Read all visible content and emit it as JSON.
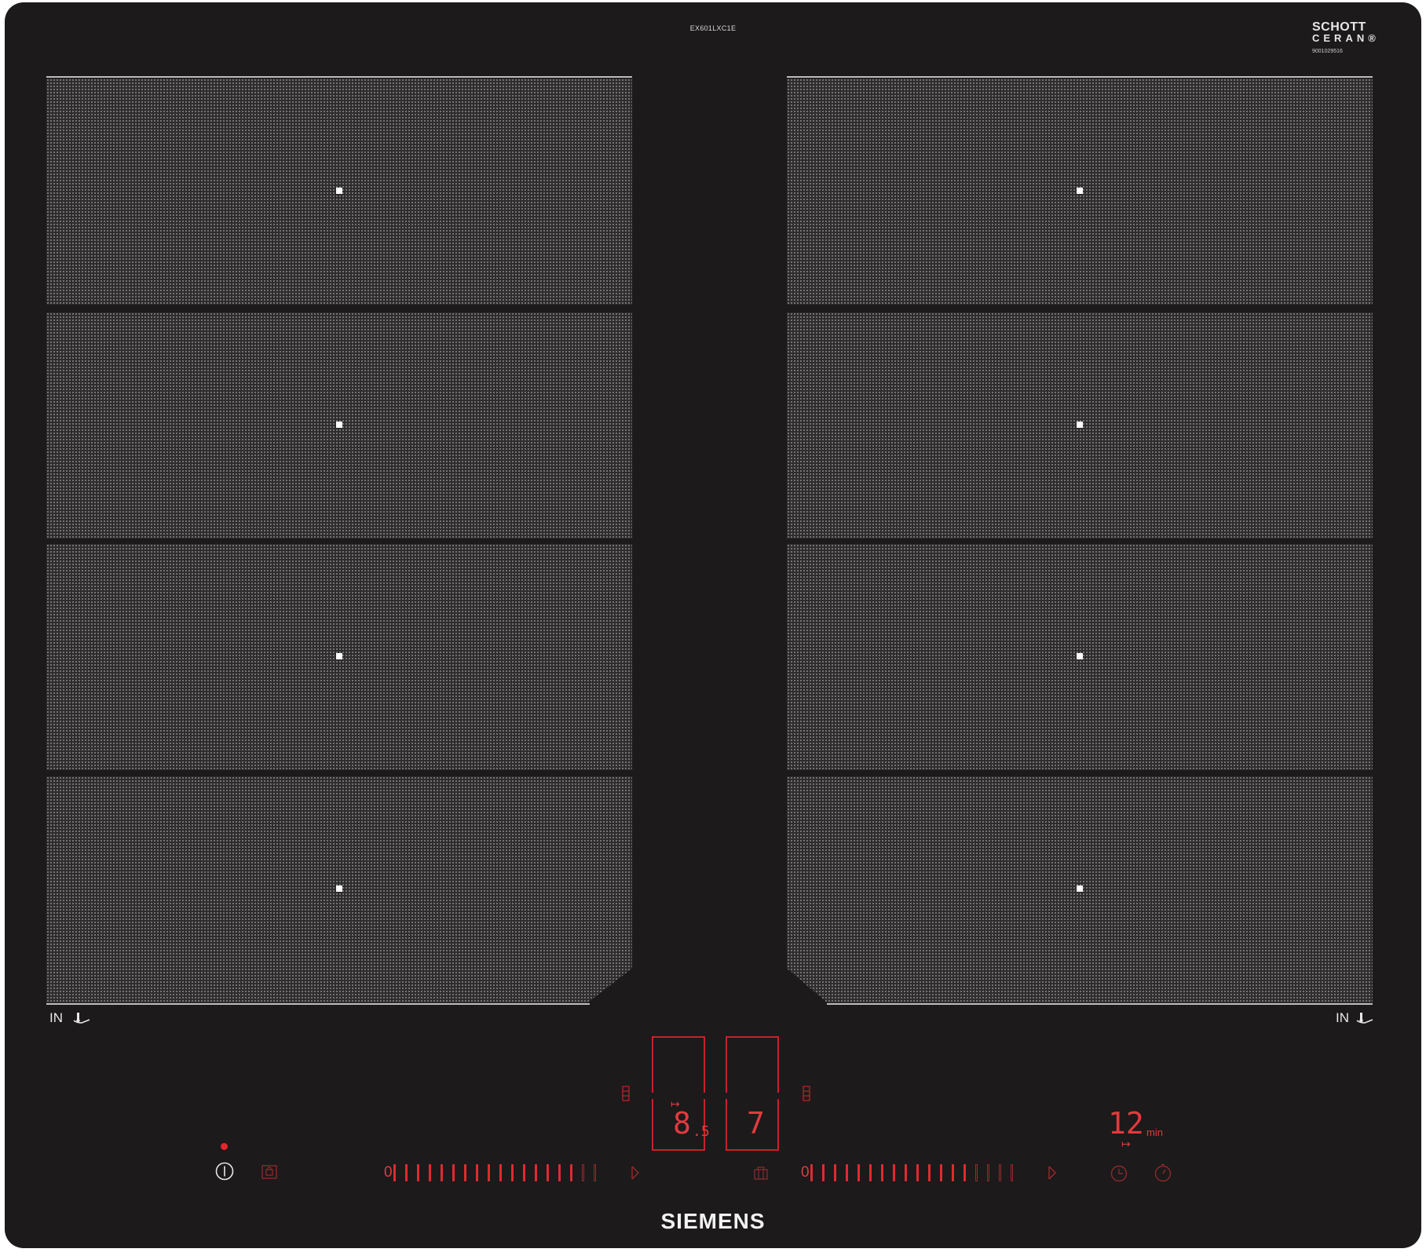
{
  "header": {
    "model": "EX601LXC1E"
  },
  "logo": {
    "line1": "SCHOTT",
    "line2": "CERAN®",
    "part_number": "9001029516"
  },
  "zones": {
    "left": [
      "",
      "",
      "",
      ""
    ],
    "right": [
      "",
      "",
      "",
      ""
    ]
  },
  "labels": {
    "induction_left": "IN",
    "induction_right": "IN"
  },
  "displays": {
    "left_main": "8",
    "left_decimal": ".5",
    "right_main": "7",
    "timer_value": "12",
    "timer_unit": "min"
  },
  "sliders": {
    "left": {
      "zero": "0",
      "active_bars": 16,
      "dim_bars": 2
    },
    "right": {
      "zero": "0",
      "active_bars": 14,
      "dim_bars": 4
    }
  },
  "brand": "SIEMENS",
  "colors": {
    "glass": "#1c1a1b",
    "display_red": "#e23a3e",
    "zone_dots": "#d2d2d2"
  },
  "icons": [
    "power-icon",
    "child-lock-icon",
    "pan-icon",
    "triangle-play-icon",
    "clock-icon",
    "stopwatch-icon",
    "timer-arrow-icon"
  ]
}
